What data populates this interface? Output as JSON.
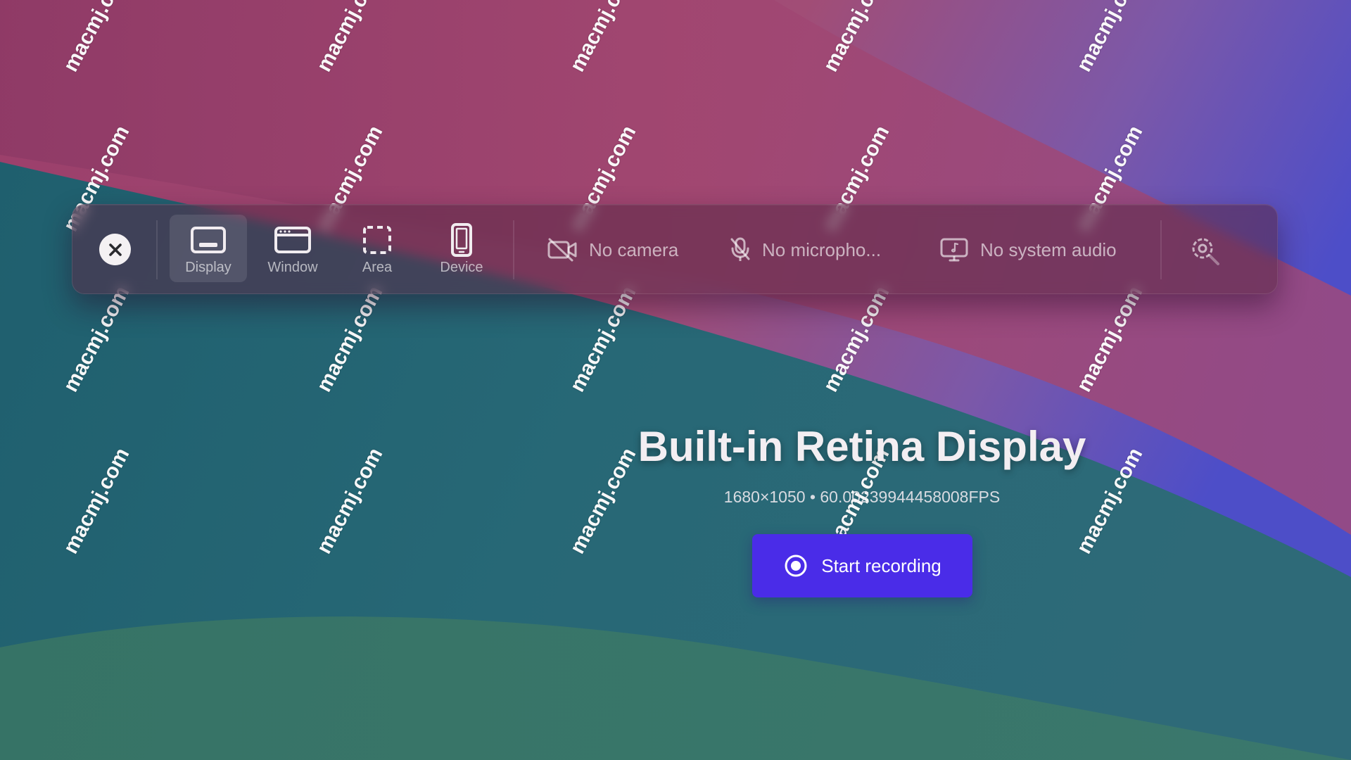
{
  "toolbar": {
    "close_label": "Close",
    "modes": [
      {
        "label": "Display",
        "icon": "display-icon",
        "active": true
      },
      {
        "label": "Window",
        "icon": "window-icon",
        "active": false
      },
      {
        "label": "Area",
        "icon": "area-selection-icon",
        "active": false
      },
      {
        "label": "Device",
        "icon": "phone-device-icon",
        "active": false
      }
    ],
    "sources": {
      "camera": {
        "label": "No camera",
        "icon": "camera-off-icon"
      },
      "microphone": {
        "label": "No micropho...",
        "icon": "microphone-off-icon"
      },
      "system_audio": {
        "label": "No system audio",
        "icon": "system-audio-icon"
      }
    },
    "settings_icon": "settings-gear-icon"
  },
  "display": {
    "title": "Built-in Retina Display",
    "info": "1680×1050 • 60.00239944458008FPS"
  },
  "start_button": {
    "label": "Start recording",
    "icon": "record-icon",
    "color": "#4a2ce8"
  },
  "watermark": {
    "text": "macmj.com"
  },
  "colors": {
    "wallpaper_pink": "#a0456e",
    "wallpaper_teal": "#2a6a78",
    "wallpaper_blue": "#4a4ec8"
  }
}
